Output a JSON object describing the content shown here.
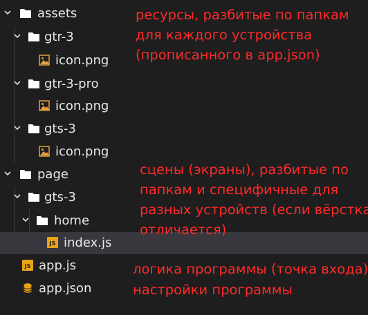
{
  "tree": {
    "rows": [
      {
        "label": "assets",
        "kind": "folder",
        "expanded": true
      },
      {
        "label": "gtr-3",
        "kind": "folder",
        "expanded": true
      },
      {
        "label": "icon.png",
        "kind": "png"
      },
      {
        "label": "gtr-3-pro",
        "kind": "folder",
        "expanded": true
      },
      {
        "label": "icon.png",
        "kind": "png"
      },
      {
        "label": "gts-3",
        "kind": "folder",
        "expanded": true
      },
      {
        "label": "icon.png",
        "kind": "png"
      },
      {
        "label": "page",
        "kind": "folder",
        "expanded": true
      },
      {
        "label": "gts-3",
        "kind": "folder",
        "expanded": true
      },
      {
        "label": "home",
        "kind": "folder",
        "expanded": true
      },
      {
        "label": "index.js",
        "kind": "js",
        "selected": true
      },
      {
        "label": "app.js",
        "kind": "js"
      },
      {
        "label": "app.json",
        "kind": "json"
      }
    ]
  },
  "annotations": {
    "assets_note": [
      "ресурсы, разбитые по папкам",
      "для каждого устройства",
      "(прописанного в app.json)"
    ],
    "page_note": [
      "сцены (экраны), разбитые по",
      "папкам и специфичные для",
      "разных устройств (если вёрстка",
      "отличается)"
    ],
    "app_js_note": "логика программы (точка входа)",
    "app_json_note": "настройки программы"
  },
  "colors": {
    "background": "#1e1e1e",
    "text": "#e8e8e8",
    "annotation": "#ff2a2a",
    "js_icon": "#e8a317",
    "png_icon": "#e8a040",
    "selection": "#37373d"
  }
}
